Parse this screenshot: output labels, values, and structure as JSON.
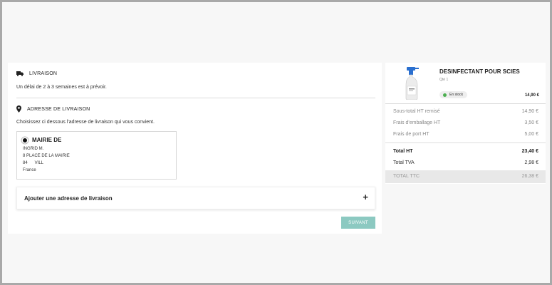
{
  "delivery": {
    "title": "LIVRAISON",
    "delay_text": "Un délai de 2 à 3 semaines est à prévoir."
  },
  "address_section": {
    "title": "ADRESSE DE LIVRAISON",
    "instruction": "Choisissez ci dessous l'adresse de livraison qui vous convient.",
    "selected_address": {
      "name": "MAIRIE DE",
      "contact": "INGRID M.",
      "street": "8 PLACE DE LA MAIRIE",
      "postal_city": "84      VILL",
      "country": "France"
    },
    "add_address_label": "Ajouter une adresse de livraison",
    "add_icon": "+"
  },
  "next_button": "SUIVANT",
  "cart": {
    "product": {
      "name": "DESINFECTANT POUR SCIES",
      "qty": "Qté 1",
      "stock": "En stock",
      "price": "14,90 €"
    },
    "summary": [
      {
        "label": "Sous-total HT remisé",
        "value": "14,90 €"
      },
      {
        "label": "Frais d'emballage HT",
        "value": "3,50 €"
      },
      {
        "label": "Frais de port HT",
        "value": "5,00 €"
      }
    ],
    "total_ht": {
      "label": "Total HT",
      "value": "23,40 €"
    },
    "total_tva": {
      "label": "Total TVA",
      "value": "2,98 €"
    },
    "total_ttc": {
      "label": "TOTAL TTC",
      "value": "26,38 €"
    }
  },
  "colors": {
    "accent_button": "#8cc9c1",
    "stock_dot": "#4caf50"
  }
}
